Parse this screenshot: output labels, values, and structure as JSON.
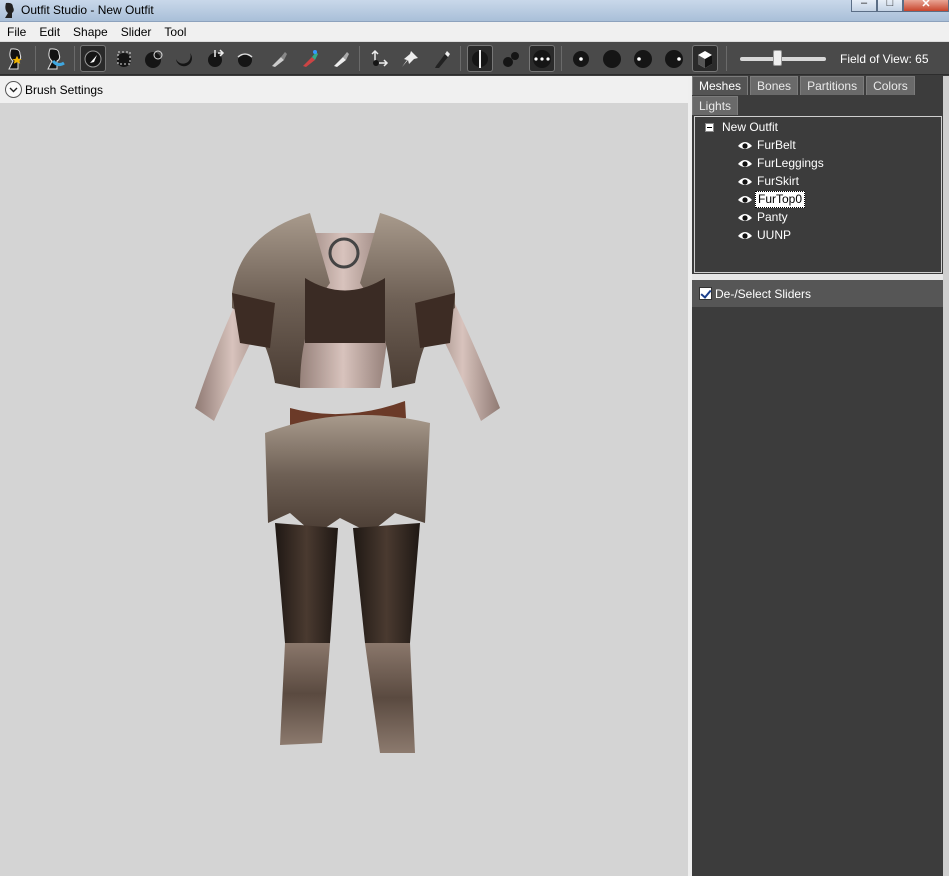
{
  "window": {
    "title": "Outfit Studio - New Outfit",
    "controls": [
      "minimize",
      "maximize",
      "close"
    ]
  },
  "menu": [
    "File",
    "Edit",
    "Shape",
    "Slider",
    "Tool"
  ],
  "toolbar": {
    "icons": [
      "load-reference-icon",
      "load-outfit-icon",
      "select-icon",
      "mask-icon",
      "inflate-icon",
      "deflate-icon",
      "move-icon",
      "smooth-icon",
      "weight-paint-icon",
      "color-paint-icon",
      "alpha-paint-icon",
      "transform-icon",
      "pivot-icon",
      "pen-icon",
      "x-mirror-icon",
      "connected-only-icon",
      "global-brush-icon",
      "brush-size-icon",
      "brush-strength-icon",
      "brush-focus-icon",
      "brush-spacing-icon",
      "texture-mode-icon"
    ],
    "fov_label": "Field of View: 65",
    "fov_value": 65
  },
  "brush_settings": {
    "label": "Brush Settings",
    "icon": "chevron-down-icon"
  },
  "right_panel": {
    "tabs": [
      "Meshes",
      "Bones",
      "Partitions",
      "Colors"
    ],
    "tabs2": [
      "Lights"
    ],
    "active_tab": "Meshes",
    "tree": {
      "root": "New Outfit",
      "items": [
        "FurBelt",
        "FurLeggings",
        "FurSkirt",
        "FurTop0",
        "Panty",
        "UUNP"
      ],
      "selected": "FurTop0"
    },
    "sliders_header": {
      "label": "De-/Select Sliders",
      "checked": true
    }
  },
  "colors": {
    "toolbar_bg": "#4a4a4a",
    "viewport_bg": "#d4d4d4",
    "panel_bg": "#3c3c3c"
  }
}
